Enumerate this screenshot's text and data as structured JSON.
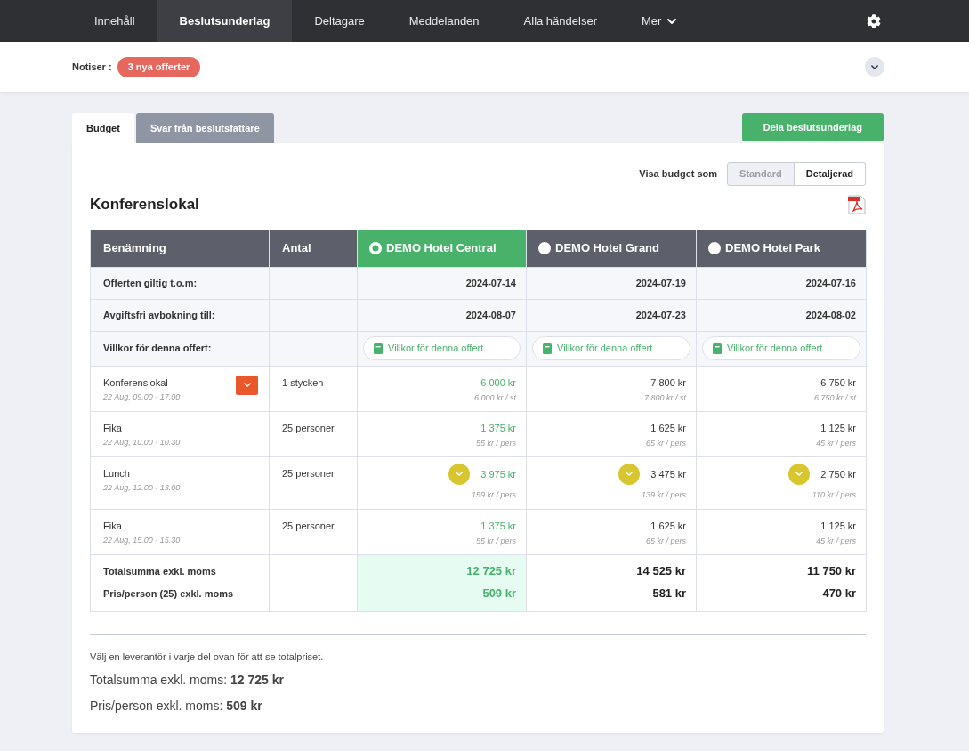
{
  "nav": {
    "items": [
      {
        "label": "Innehåll",
        "selected": false,
        "kind": "link"
      },
      {
        "label": "Beslutsunderlag",
        "selected": true,
        "kind": "link"
      },
      {
        "label": "Deltagare",
        "selected": false,
        "kind": "link"
      },
      {
        "label": "Meddelanden",
        "selected": false,
        "kind": "link"
      },
      {
        "label": "Alla händelser",
        "selected": false,
        "kind": "link"
      },
      {
        "label": "Mer",
        "selected": false,
        "kind": "menu"
      }
    ]
  },
  "notices": {
    "label": "Notiser :",
    "badge": "3 nya offerter"
  },
  "tabs": [
    {
      "label": "Budget",
      "selected": true
    },
    {
      "label": "Svar från beslutsfattare",
      "selected": false
    }
  ],
  "share_button": "Dela beslutsunderlag",
  "view_toggle": {
    "label": "Visa budget som",
    "options": [
      {
        "label": "Standard",
        "selected": true
      },
      {
        "label": "Detaljerad",
        "selected": false
      }
    ]
  },
  "section": {
    "title": "Konferenslokal",
    "table": {
      "columns": [
        "Benämning",
        "Antal"
      ],
      "suppliers": [
        {
          "name": "DEMO Hotel Central",
          "selected": true
        },
        {
          "name": "DEMO Hotel Grand",
          "selected": false
        },
        {
          "name": "DEMO Hotel Park",
          "selected": false
        }
      ],
      "info_rows": [
        {
          "label": "Offerten giltig t.o.m:",
          "kind": "text",
          "values": [
            "2024-07-14",
            "2024-07-19",
            "2024-07-16"
          ]
        },
        {
          "label": "Avgiftsfri avbokning till:",
          "kind": "text",
          "values": [
            "2024-08-07",
            "2024-07-23",
            "2024-08-02"
          ]
        },
        {
          "label": "Villkor för denna offert:",
          "kind": "link",
          "values": [
            "Villkor för denna offert",
            "Villkor för denna offert",
            "Villkor för denna offert"
          ]
        }
      ],
      "items": [
        {
          "name": "Konferenslokal",
          "time": "22 Aug, 09.00 - 17.00",
          "quantity": "1 stycken",
          "expandable": true,
          "offers": [
            {
              "price": "6 000 kr",
              "unit_price": "6 000 kr / st",
              "expandable": false
            },
            {
              "price": "7 800 kr",
              "unit_price": "7 800 kr / st",
              "expandable": false
            },
            {
              "price": "6 750 kr",
              "unit_price": "6 750 kr / st",
              "expandable": false
            }
          ]
        },
        {
          "name": "Fika",
          "time": "22 Aug, 10.00 - 10.30",
          "quantity": "25 personer",
          "expandable": false,
          "offers": [
            {
              "price": "1 375 kr",
              "unit_price": "55 kr / pers",
              "expandable": false
            },
            {
              "price": "1 625 kr",
              "unit_price": "65 kr / pers",
              "expandable": false
            },
            {
              "price": "1 125 kr",
              "unit_price": "45 kr / pers",
              "expandable": false
            }
          ]
        },
        {
          "name": "Lunch",
          "time": "22 Aug, 12.00 - 13.00",
          "quantity": "25 personer",
          "expandable": false,
          "offers": [
            {
              "price": "3 975 kr",
              "unit_price": "159 kr / pers",
              "expandable": true
            },
            {
              "price": "3 475 kr",
              "unit_price": "139 kr / pers",
              "expandable": true
            },
            {
              "price": "2 750 kr",
              "unit_price": "110 kr / pers",
              "expandable": true
            }
          ]
        },
        {
          "name": "Fika",
          "time": "22 Aug, 15.00 - 15.30",
          "quantity": "25 personer",
          "expandable": false,
          "offers": [
            {
              "price": "1 375 kr",
              "unit_price": "55 kr / pers",
              "expandable": false
            },
            {
              "price": "1 625 kr",
              "unit_price": "65 kr / pers",
              "expandable": false
            },
            {
              "price": "1 125 kr",
              "unit_price": "45 kr / pers",
              "expandable": false
            }
          ]
        }
      ],
      "totals": [
        {
          "label": "Totalsumma exkl. moms",
          "values": [
            "12 725 kr",
            "14 525 kr",
            "11 750 kr"
          ]
        },
        {
          "label": "Pris/person (25) exkl. moms",
          "values": [
            "509 kr",
            "581 kr",
            "470 kr"
          ]
        }
      ]
    }
  },
  "footer": {
    "hint": "Välj en leverantör i varje del ovan för att se totalpriset.",
    "lines": [
      "Totalsumma exkl. moms: **12 725 kr**",
      "Pris/person exkl. moms: **509 kr**"
    ]
  }
}
